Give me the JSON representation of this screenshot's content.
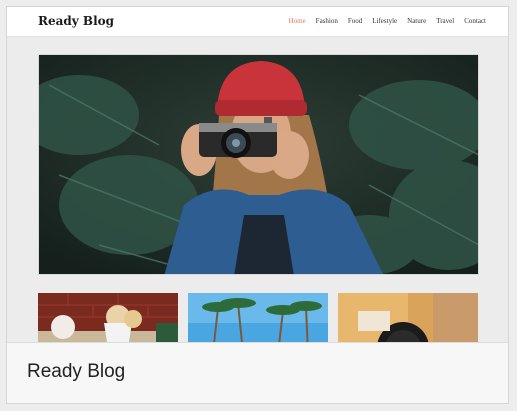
{
  "header": {
    "logo": "Ready Blog",
    "nav": [
      {
        "label": "Home",
        "active": true
      },
      {
        "label": "Fashion",
        "active": false
      },
      {
        "label": "Food",
        "active": false
      },
      {
        "label": "Lifestyle",
        "active": false
      },
      {
        "label": "Nature",
        "active": false
      },
      {
        "label": "Travel",
        "active": false
      },
      {
        "label": "Contact",
        "active": false
      }
    ]
  },
  "footer": {
    "title": "Ready Blog"
  },
  "colors": {
    "accent": "#e07b59",
    "hero_bg": "#1f2b27",
    "beanie": "#c9343a",
    "jacket": "#2e5d91"
  }
}
